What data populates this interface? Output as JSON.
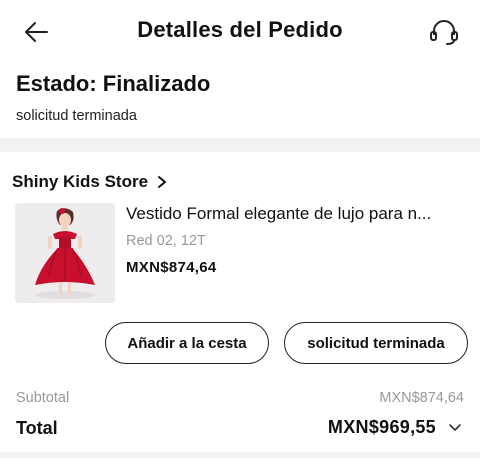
{
  "header": {
    "title": "Detalles del Pedido",
    "back_icon": "arrow-left-icon",
    "support_icon": "headset-icon"
  },
  "status": {
    "title": "Estado: Finalizado",
    "subtitle": "solicitud terminada"
  },
  "store": {
    "name": "Shiny Kids Store",
    "chevron_icon": "chevron-right-icon"
  },
  "product": {
    "name": "Vestido Formal elegante de lujo para n...",
    "variant": "Red 02, 12T",
    "price": "MXN$874,64",
    "image": "red-dress-thumbnail"
  },
  "actions": {
    "add_to_cart": "Añadir a la cesta",
    "request_done": "solicitud terminada"
  },
  "summary": {
    "subtotal_label": "Subtotal",
    "subtotal_value": "MXN$874,64",
    "total_label": "Total",
    "total_value": "MXN$969,55",
    "expand_icon": "chevron-down-icon"
  },
  "colors": {
    "text": "#111111",
    "muted": "#999999",
    "divider": "#f2f2f2",
    "dress": "#c8102e"
  }
}
